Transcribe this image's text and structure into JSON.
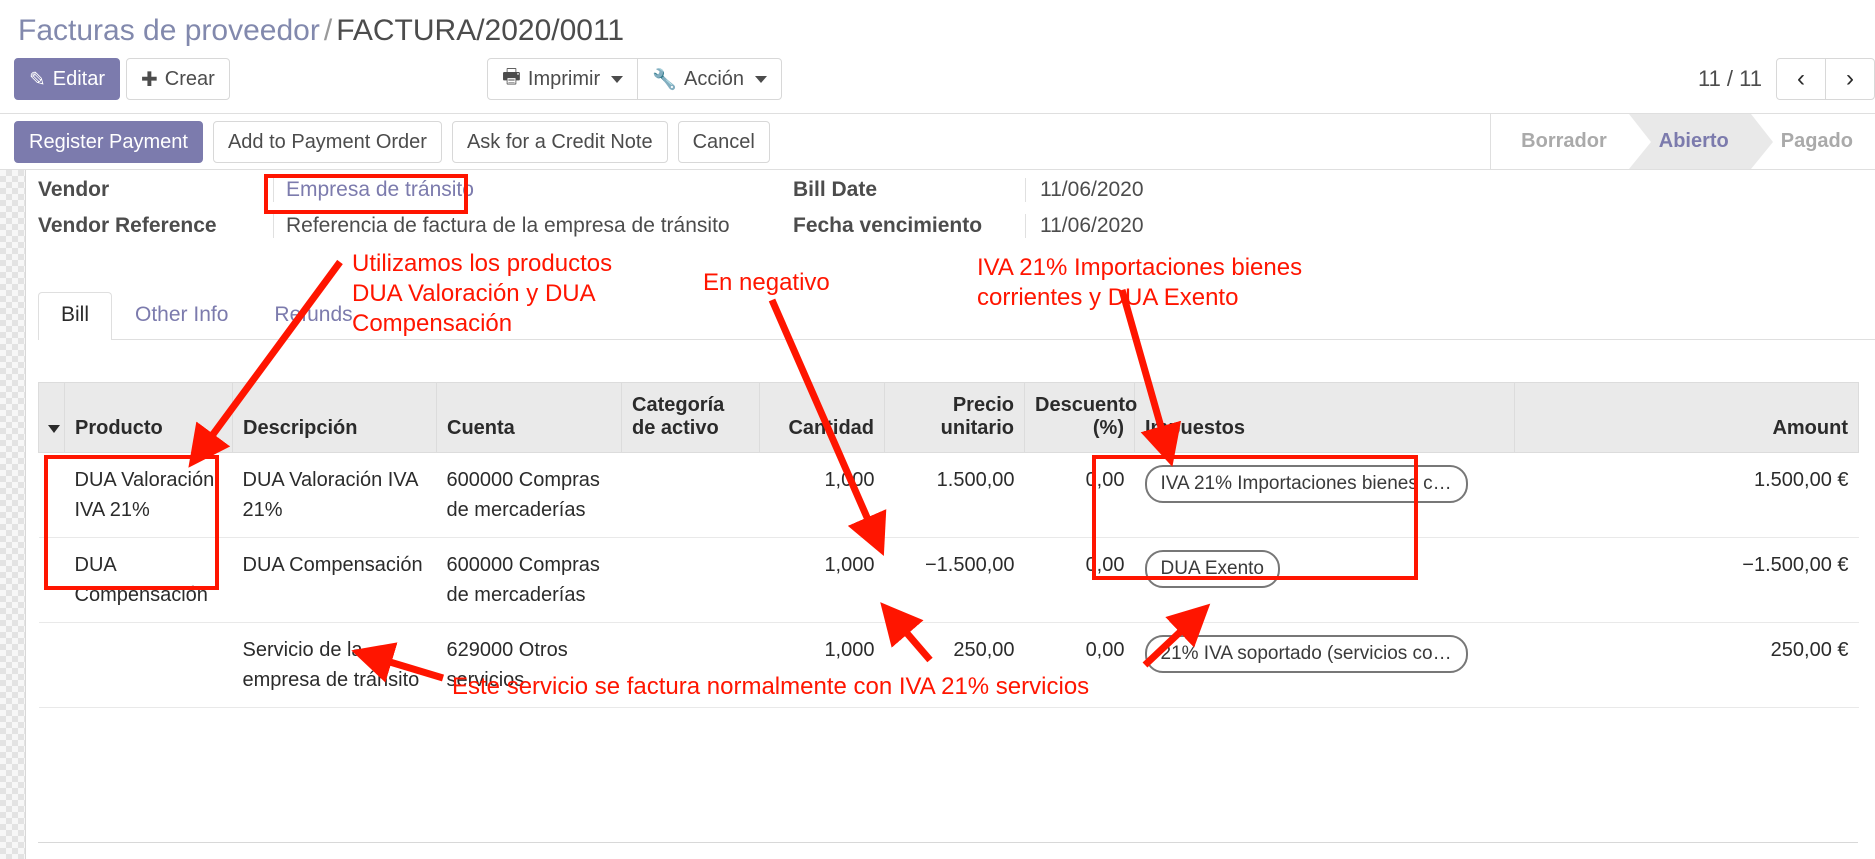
{
  "breadcrumb": {
    "parent": "Facturas de proveedor",
    "separator": "/",
    "current": "FACTURA/2020/0011"
  },
  "control_panel": {
    "edit_label": "Editar",
    "create_label": "Crear",
    "print_label": "Imprimir",
    "action_label": "Acción",
    "pager_count": "11 / 11",
    "prev_glyph": "‹",
    "next_glyph": "›"
  },
  "status_row": {
    "buttons": [
      "Register Payment",
      "Add to Payment Order",
      "Ask for a Credit Note",
      "Cancel"
    ],
    "stages": [
      {
        "label": "Borrador",
        "active": false
      },
      {
        "label": "Abierto",
        "active": true
      },
      {
        "label": "Pagado",
        "active": false
      }
    ]
  },
  "form": {
    "left": [
      {
        "label": "Vendor",
        "value": "Empresa de tránsito",
        "link": true
      },
      {
        "label": "Vendor Reference",
        "value": "Referencia de factura de la empresa de tránsito",
        "link": false
      }
    ],
    "right": [
      {
        "label": "Bill Date",
        "value": "11/06/2020"
      },
      {
        "label": "Fecha vencimiento",
        "value": "11/06/2020"
      }
    ]
  },
  "tabs": [
    {
      "label": "Bill",
      "active": true
    },
    {
      "label": "Other Info",
      "active": false
    },
    {
      "label": "Refunds",
      "active": false
    }
  ],
  "table": {
    "headers": [
      "Producto",
      "Descripción",
      "Cuenta",
      "Categoría de activo",
      "Cantidad",
      "Precio unitario",
      "Descuento (%)",
      "Impuestos",
      "Amount"
    ],
    "rows": [
      {
        "producto": "DUA Valoración IVA 21%",
        "descripcion": "DUA Valoración IVA 21%",
        "cuenta": "600000 Compras de mercaderías",
        "categoria": "",
        "cantidad": "1,000",
        "precio": "1.500,00",
        "descuento": "0,00",
        "impuestos": "IVA 21% Importaciones bienes c…",
        "amount": "1.500,00 €"
      },
      {
        "producto": "DUA Compensación",
        "descripcion": "DUA Compensación",
        "cuenta": "600000 Compras de mercaderías",
        "categoria": "",
        "cantidad": "1,000",
        "precio": "−1.500,00",
        "descuento": "0,00",
        "impuestos": "DUA Exento",
        "amount": "−1.500,00 €"
      },
      {
        "producto": "",
        "descripcion": "Servicio de la empresa de tránsito",
        "cuenta": "629000 Otros servicios",
        "categoria": "",
        "cantidad": "1,000",
        "precio": "250,00",
        "descuento": "0,00",
        "impuestos": "21% IVA soportado (servicios co…",
        "amount": "250,00 €"
      }
    ]
  },
  "annotations": {
    "color": "#ff1500",
    "note_products": "Utilizamos los productos\nDUA Valoración y DUA\nCompensación",
    "note_negative": "En negativo",
    "note_taxes": "IVA 21% Importaciones bienes\ncorrientes y DUA Exento",
    "note_service": "Este servicio se factura normalmente con IVA 21% servicios"
  }
}
